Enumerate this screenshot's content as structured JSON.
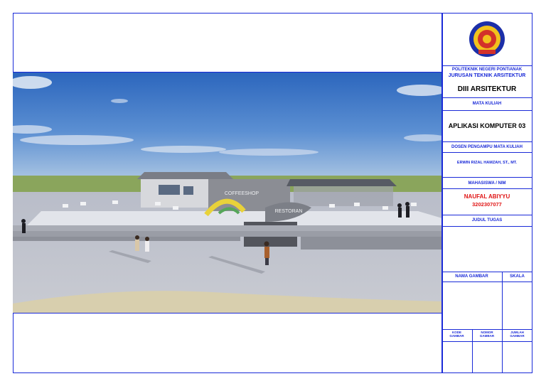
{
  "title_block": {
    "institution": "POLITEKNIK NEGERI PONTIANAK",
    "department": "JURUSAN TEKNIK ARSITEKTUR",
    "program": "DIII ARSITEKTUR",
    "course_label": "MATA KULIAH",
    "course": "APLIKASI KOMPUTER 03",
    "lecturer_label": "DOSEN PENGAMPU MATA KULIAH",
    "lecturer": "ERWIN RIZAL HAMZAH, ST., MT.",
    "student_label": "MAHASISWA / NIM",
    "student_name": "NAUFAL ABIYYU",
    "student_id": "3202307077",
    "assignment_label": "JUDUL TUGAS",
    "drawing_name_label": "NAMA GAMBAR",
    "scale_label": "SKALA",
    "drawing_code_label": [
      "KODE",
      "GAMBAR"
    ],
    "drawing_number_label": [
      "NOMOR",
      "GAMBAR"
    ],
    "drawing_count_label": [
      "JUMLAH",
      "GAMBAR"
    ]
  },
  "render": {
    "sign_coffeeshop": "COFFEESHOP",
    "sign_restoran": "RESTORAN"
  },
  "colors": {
    "border": "#1a2ad8",
    "accent_red": "#e01515"
  },
  "icons": {
    "logo": "politeknik-logo"
  }
}
